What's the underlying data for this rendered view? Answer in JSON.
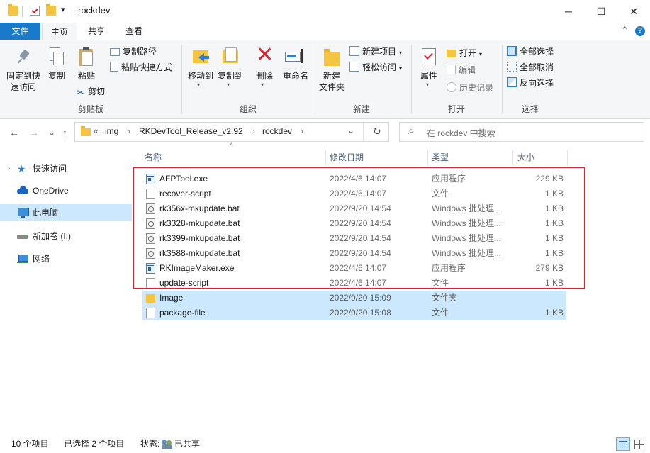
{
  "window": {
    "title": "rockdev",
    "minimize_glyph": "─",
    "maximize_glyph": "☐",
    "close_glyph": "✕",
    "qa_dropdown_glyph": "▾"
  },
  "ribbon_tabs": {
    "file": "文件",
    "home": "主页",
    "share": "共享",
    "view": "查看",
    "collapse_glyph": "⌃",
    "help_glyph": "?"
  },
  "ribbon": {
    "clipboard": {
      "pin": "固定到快\n速访问",
      "copy": "复制",
      "paste": "粘贴",
      "copy_path": "复制路径",
      "paste_shortcut": "粘贴快捷方式",
      "cut": "剪切",
      "group": "剪贴板"
    },
    "organize": {
      "move_to": "移动到",
      "copy_to": "复制到",
      "delete": "删除",
      "rename": "重命名",
      "group": "组织"
    },
    "new": {
      "new_folder": "新建\n文件夹",
      "new_item": "新建项目",
      "easy_access": "轻松访问",
      "group": "新建"
    },
    "open": {
      "properties": "属性",
      "open": "打开",
      "edit": "编辑",
      "history": "历史记录",
      "group": "打开"
    },
    "select": {
      "select_all": "全部选择",
      "select_none": "全部取消",
      "invert": "反向选择",
      "group": "选择"
    }
  },
  "nav": {
    "back_glyph": "←",
    "forward_glyph": "→",
    "recent_glyph": "⌄",
    "up_glyph": "↑",
    "breadcrumb_prefix": "«",
    "breadcrumb": [
      "img",
      "RKDevTool_Release_v2.92",
      "rockdev"
    ],
    "breadcrumb_sep": "›",
    "dropdown_glyph": "⌄",
    "refresh_glyph": "↻",
    "search_glyph": "⌕",
    "search_placeholder": "在 rockdev 中搜索"
  },
  "sidebar": {
    "items": [
      {
        "label": "快速访问",
        "icon": "star-icon"
      },
      {
        "label": "OneDrive",
        "icon": "cloud-icon"
      },
      {
        "label": "此电脑",
        "icon": "computer-icon"
      },
      {
        "label": "新加卷 (I:)",
        "icon": "drive-icon"
      },
      {
        "label": "网络",
        "icon": "network-icon"
      }
    ],
    "expand_glyph": "›"
  },
  "columns": {
    "name": "名称",
    "date": "修改日期",
    "type": "类型",
    "size": "大小",
    "sort_glyph": "^"
  },
  "files": [
    {
      "name": "AFPTool.exe",
      "date": "2022/4/6 14:07",
      "type": "应用程序",
      "size": "229 KB",
      "icon": "exe"
    },
    {
      "name": "recover-script",
      "date": "2022/4/6 14:07",
      "type": "文件",
      "size": "1 KB",
      "icon": "file"
    },
    {
      "name": "rk356x-mkupdate.bat",
      "date": "2022/9/20 14:54",
      "type": "Windows 批处理...",
      "size": "1 KB",
      "icon": "bat"
    },
    {
      "name": "rk3328-mkupdate.bat",
      "date": "2022/9/20 14:54",
      "type": "Windows 批处理...",
      "size": "1 KB",
      "icon": "bat"
    },
    {
      "name": "rk3399-mkupdate.bat",
      "date": "2022/9/20 14:54",
      "type": "Windows 批处理...",
      "size": "1 KB",
      "icon": "bat"
    },
    {
      "name": "rk3588-mkupdate.bat",
      "date": "2022/9/20 14:54",
      "type": "Windows 批处理...",
      "size": "1 KB",
      "icon": "bat"
    },
    {
      "name": "RKImageMaker.exe",
      "date": "2022/4/6 14:07",
      "type": "应用程序",
      "size": "279 KB",
      "icon": "exe"
    },
    {
      "name": "update-script",
      "date": "2022/4/6 14:07",
      "type": "文件",
      "size": "1 KB",
      "icon": "file"
    },
    {
      "name": "Image",
      "date": "2022/9/20 15:09",
      "type": "文件夹",
      "size": "",
      "icon": "folder"
    },
    {
      "name": "package-file",
      "date": "2022/9/20 15:08",
      "type": "文件",
      "size": "1 KB",
      "icon": "file"
    }
  ],
  "status": {
    "count": "10 个项目",
    "selected": "已选择 2 个项目",
    "state_label": "状态:",
    "state_value": "已共享"
  },
  "colors": {
    "file_tab": "#1979ca",
    "selection": "#cce8ff",
    "highlight_box": "#d9232e"
  }
}
